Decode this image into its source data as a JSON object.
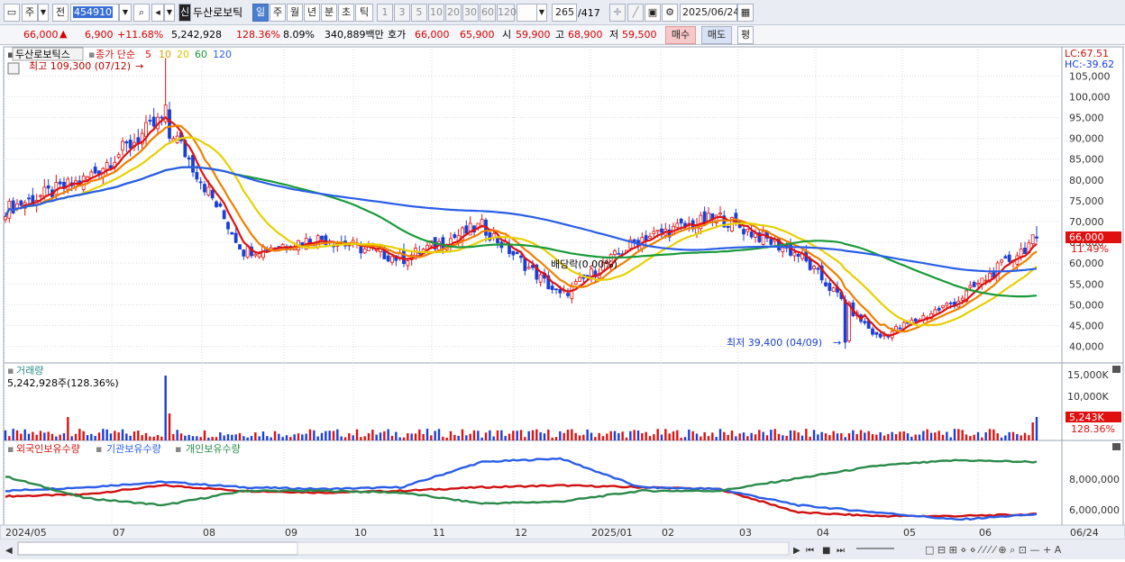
{
  "toolbar": {
    "market": "주",
    "prev": "전",
    "code": "454910",
    "shin_badge": "신",
    "name": "두산로보틱",
    "periods": [
      "일",
      "주",
      "월",
      "년",
      "분",
      "초",
      "틱"
    ],
    "minutes": [
      "1",
      "3",
      "5",
      "10",
      "20",
      "30",
      "60",
      "120"
    ],
    "count": "265",
    "total": "/417",
    "date": "2025/06/24"
  },
  "quote": {
    "price": "66,000",
    "change": "6,900",
    "change_pct": "+11.68%",
    "volume": "5,242,928",
    "vol_ratio": "128.36%",
    "turnover": "8.09%",
    "amount": "340,889백만",
    "hoga_label": "호가",
    "ask": "66,000",
    "bid": "65,900",
    "open_label": "시",
    "open": "59,900",
    "high_label": "고",
    "high": "68,900",
    "low_label": "저",
    "low": "59,500",
    "buy": "매수",
    "sell": "매도",
    "avg": "평"
  },
  "legend": {
    "name": "두산로보틱스",
    "close_simple": "종가 단순",
    "ma": [
      {
        "label": "5",
        "color": "#e01010"
      },
      {
        "label": "10",
        "color": "#f08000"
      },
      {
        "label": "20",
        "color": "#e8d000"
      },
      {
        "label": "60",
        "color": "#1a9a3a"
      },
      {
        "label": "120",
        "color": "#2a5ee8"
      }
    ],
    "lc": "LC:67.51",
    "hc": "HC:-39.62"
  },
  "annotations": {
    "high": "최고 109,300 (07/12)",
    "low": "최저 39,400 (04/09)",
    "dividend": "배당락(0.00%)"
  },
  "price_axis": [
    "105,000",
    "100,000",
    "95,000",
    "90,000",
    "85,000",
    "80,000",
    "75,000",
    "70,000",
    "65,000",
    "60,000",
    "55,000",
    "50,000",
    "45,000",
    "40,000"
  ],
  "price_tag": {
    "price": "66,000",
    "pct": "11.49%"
  },
  "volume_panel": {
    "title": "거래량",
    "value": "5,242,928주(128.36%)",
    "axis": [
      "15,000K",
      "10,000K"
    ],
    "tag_value": "5,243K",
    "tag_pct": "128.36%"
  },
  "holdings_panel": {
    "series": [
      {
        "label": "외국인보유수량",
        "color": "#d01010"
      },
      {
        "label": "기관보유수량",
        "color": "#2a5ee8"
      },
      {
        "label": "개인보유수량",
        "color": "#2a8a4a"
      }
    ],
    "axis": [
      "8,000,000",
      "6,000,000"
    ]
  },
  "x_axis": [
    "2024/05",
    "07",
    "08",
    "09",
    "10",
    "11",
    "12",
    "2025/01",
    "02",
    "03",
    "04",
    "05",
    "06",
    "06/24"
  ],
  "colors": {
    "up": "#e01010",
    "down": "#1a3fd6",
    "ma5": "#e01010",
    "ma10": "#f08000",
    "ma20": "#e8d000",
    "ma60": "#1a9a3a",
    "ma120": "#2a5ee8"
  },
  "icons": [
    "layout-icon",
    "search-icon",
    "speaker-icon",
    "crosshair-icon",
    "trendline-icon",
    "save-icon",
    "gear-icon",
    "calendar-icon"
  ],
  "chart_data": {
    "type": "candlestick",
    "period": "daily",
    "price_range": [
      36000,
      112000
    ],
    "series": [
      {
        "name": "MA5",
        "color": "#e01010"
      },
      {
        "name": "MA10",
        "color": "#f08000"
      },
      {
        "name": "MA20",
        "color": "#e8d000"
      },
      {
        "name": "MA60",
        "color": "#1a9a3a"
      },
      {
        "name": "MA120",
        "color": "#2a5ee8"
      }
    ],
    "approx_close_path": [
      [
        "2024/05",
        73000
      ],
      [
        "2024/06",
        80000
      ],
      [
        "2024/07",
        95000
      ],
      [
        "2024/08",
        63000
      ],
      [
        "2024/09",
        66000
      ],
      [
        "2024/10",
        61000
      ],
      [
        "2024/11",
        69000
      ],
      [
        "2024/12",
        52000
      ],
      [
        "2025/01",
        66000
      ],
      [
        "2025/02",
        71000
      ],
      [
        "2025/03",
        62000
      ],
      [
        "2025/04",
        42000
      ],
      [
        "2025/05",
        51000
      ],
      [
        "2025/06",
        66000
      ]
    ],
    "high": {
      "value": 109300,
      "date": "07/12"
    },
    "low": {
      "value": 39400,
      "date": "04/09"
    },
    "last": {
      "value": 66000,
      "date": "06/24"
    }
  }
}
